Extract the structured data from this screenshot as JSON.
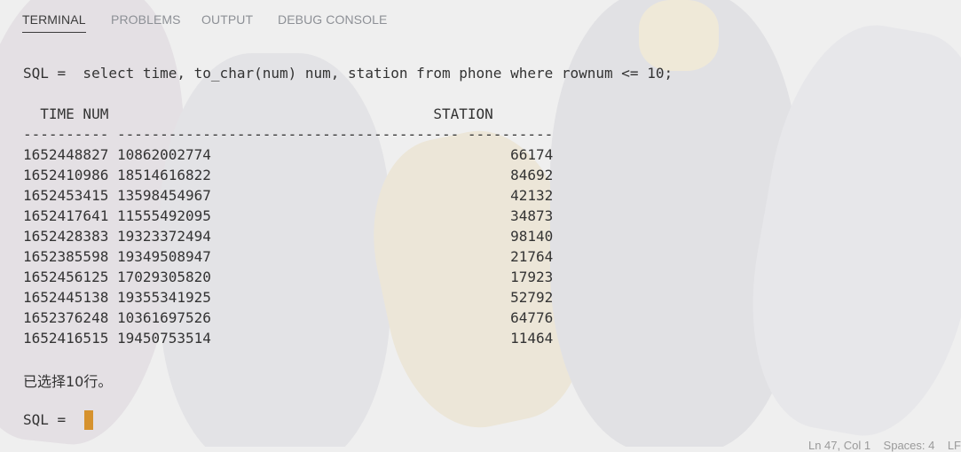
{
  "tabs": {
    "terminal": "TERMINAL",
    "problems": "PROBLEMS",
    "output": "OUTPUT",
    "debug_console": "DEBUG CONSOLE"
  },
  "terminal": {
    "sql_command": "SQL =  select time, to_char(num) num, station from phone where rownum <= 10;",
    "header": "  TIME NUM                                      STATION",
    "separator": "---------- ---------------------------------------- ----------",
    "rows": [
      "1652448827 10862002774                                   66174",
      "1652410986 18514616822                                   84692",
      "1652453415 13598454967                                   42132",
      "1652417641 11555492095                                   34873",
      "1652428383 19323372494                                   98140",
      "1652385598 19349508947                                   21764",
      "1652456125 17029305820                                   17923",
      "1652445138 19355341925                                   52792",
      "1652376248 10361697526                                   64776",
      "1652416515 19450753514                                   11464"
    ],
    "result_message": "已选择10行。",
    "prompt": "SQL = "
  },
  "status_bar": {
    "position": "Ln 47, Col 1",
    "spaces": "Spaces: 4",
    "eol": "LF"
  }
}
